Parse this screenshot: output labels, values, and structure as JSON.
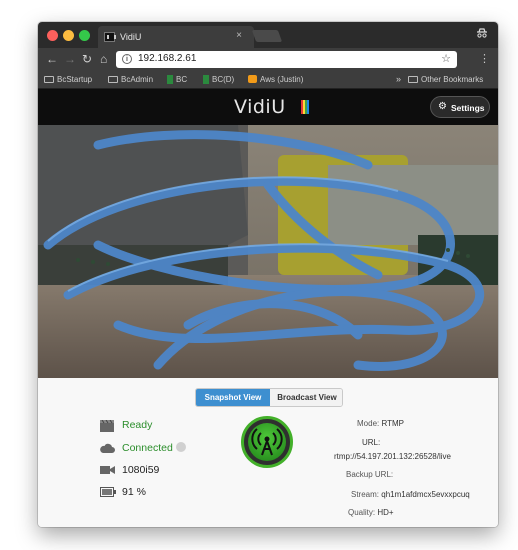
{
  "browser": {
    "tab_title": "VidiU",
    "tab_close": "×",
    "url": "192.168.2.61",
    "bookmarks": [
      {
        "label": "BcStartup",
        "icon": "folder-icon"
      },
      {
        "label": "BcAdmin",
        "icon": "folder-icon"
      },
      {
        "label": "BC",
        "icon": "bookmark-icon"
      },
      {
        "label": "BC(D)",
        "icon": "bookmark-icon"
      },
      {
        "label": "Aws (Justin)",
        "icon": "aws-icon"
      }
    ],
    "bookmarks_overflow": "»",
    "other_bookmarks": "Other Bookmarks"
  },
  "app": {
    "logo_text": "VidiU",
    "settings_label": "Settings"
  },
  "view_toggle": {
    "snapshot_label": "Snapshot View",
    "broadcast_label": "Broadcast View",
    "selected": "Snapshot View"
  },
  "status": {
    "state": "Ready",
    "connection": "Connected",
    "resolution": "1080i59",
    "battery": "91 %"
  },
  "stream_info": {
    "mode_label": "Mode:",
    "mode_value": "RTMP",
    "url_label": "URL:",
    "url_value": "rtmp://54.197.201.132:26528/live",
    "backup_url_label": "Backup URL:",
    "backup_url_value": "",
    "stream_label": "Stream:",
    "stream_value": "qh1m1afdmcx5evxxpcuq",
    "quality_label": "Quality:",
    "quality_value": "HD+"
  },
  "colors": {
    "accent_blue": "#3d8fd0",
    "status_green": "#2c8e2c",
    "broadcast_green": "#43b02a"
  }
}
